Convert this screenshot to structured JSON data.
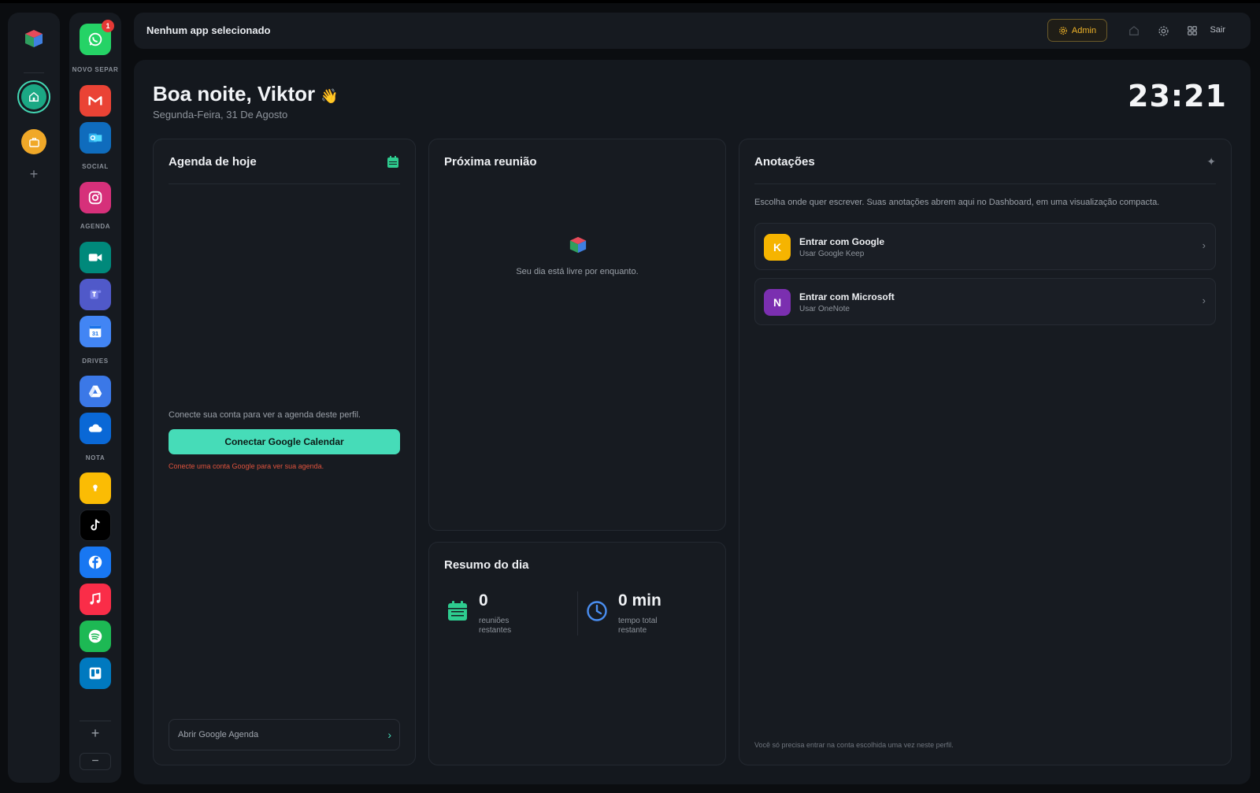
{
  "header": {
    "title": "Nenhum app selecionado",
    "admin_label": "Admin",
    "logout_label": "Sair"
  },
  "sidebar": {
    "whatsapp_badge": "1",
    "groups": {
      "novo_separ": "NOVO SEPAR",
      "social": "SOCIAL",
      "agenda": "AGENDA",
      "drives": "DRIVES",
      "nota": "NOTA"
    },
    "apps": [
      "whatsapp",
      "gmail",
      "outlook",
      "instagram",
      "google-meet",
      "teams",
      "google-calendar",
      "google-drive",
      "onedrive",
      "google-keep",
      "tiktok",
      "facebook",
      "apple-music",
      "spotify",
      "trello"
    ]
  },
  "greeting": {
    "text": "Boa noite, Viktor",
    "emoji": "👋",
    "date": "Segunda-Feira, 31 De Agosto",
    "time": "23:21"
  },
  "agenda": {
    "title": "Agenda de hoje",
    "message": "Conecte sua conta para ver a agenda deste perfil.",
    "connect_label": "Conectar Google Calendar",
    "error": "Conecte uma conta Google para ver sua agenda.",
    "open_label": "Abrir Google Agenda"
  },
  "next_meeting": {
    "title": "Próxima reunião",
    "message": "Seu dia está livre por enquanto."
  },
  "summary": {
    "title": "Resumo do dia",
    "meetings_value": "0",
    "meetings_label": "reuniões restantes",
    "time_value": "0 min",
    "time_label": "tempo total restante"
  },
  "notes": {
    "title": "Anotações",
    "description": "Escolha onde quer escrever. Suas anotações abrem aqui no Dashboard, em uma visualização compacta.",
    "accounts": [
      {
        "letter": "K",
        "name": "Entrar com Google",
        "sub": "Usar Google Keep",
        "color": "#f6b400"
      },
      {
        "letter": "N",
        "name": "Entrar com Microsoft",
        "sub": "Usar OneNote",
        "color": "#7b2fb0"
      }
    ],
    "footer": "Você só precisa entrar na conta escolhida uma vez neste perfil."
  },
  "colors": {
    "accent": "#46dcb8",
    "admin": "#f0b429",
    "error": "#e0533d"
  }
}
